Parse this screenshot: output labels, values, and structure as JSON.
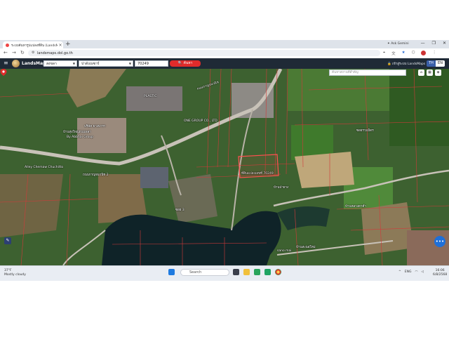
{
  "browser": {
    "tab_title": "ระบบค้นหารูปแปลงที่ดิน (LandsMaps)",
    "new_tab": "+",
    "gemini": "Ask Gemini",
    "url": "landsmaps.dol.go.th",
    "window_controls": [
      "—",
      "❐",
      "✕"
    ]
  },
  "app": {
    "brand": "LandsMaps",
    "province": "สงขลา",
    "district": "ปาดังเบซาร์",
    "parcel_number": "70249",
    "search_label": "ค้นหา",
    "portal_link": "เข้าสู่ระบบ LandsMaps",
    "lang_th": "TH",
    "lang_en": "EN"
  },
  "map": {
    "search_placeholder": "ค้นหาสถานที่สำคัญ",
    "labels": {
      "plastic1": "PLASTIC",
      "plastic2": "ONE GROUP CO., LTD",
      "road_name": "ถนนกาญจนวนิช",
      "factory": "By Abbhai Group",
      "school": "บ้านทุ่งใหญ่ถนนพลา",
      "alley": "Alley Chemaw Chuchitto",
      "highway": "ถนนกาญจนวนิช 2",
      "west_bldg": "บริษัท ยางพารา",
      "parcel_label": "ที่ดินแปลงเลขที่ 70249",
      "green_label": "บ้านป่ายาง",
      "ne1": "ซอยรวมมิตร",
      "ne2": "บ้านหลวงตาคำ",
      "sano_mai": "sano mai",
      "sano_mai_th": "บ้านสะนอใหม่",
      "south_road": "ซอย 3"
    }
  },
  "taskbar": {
    "weather_temp": "37°F",
    "weather_desc": "Mostly cloudy",
    "search": "Search",
    "lang": "ENG",
    "time": "16:06",
    "date": "6/8/2568"
  },
  "colors": {
    "header_bg": "#1f2a36",
    "search_btn": "#e02b2b",
    "parcel_line": "#d23a3a",
    "pin": "#e02b2b"
  }
}
